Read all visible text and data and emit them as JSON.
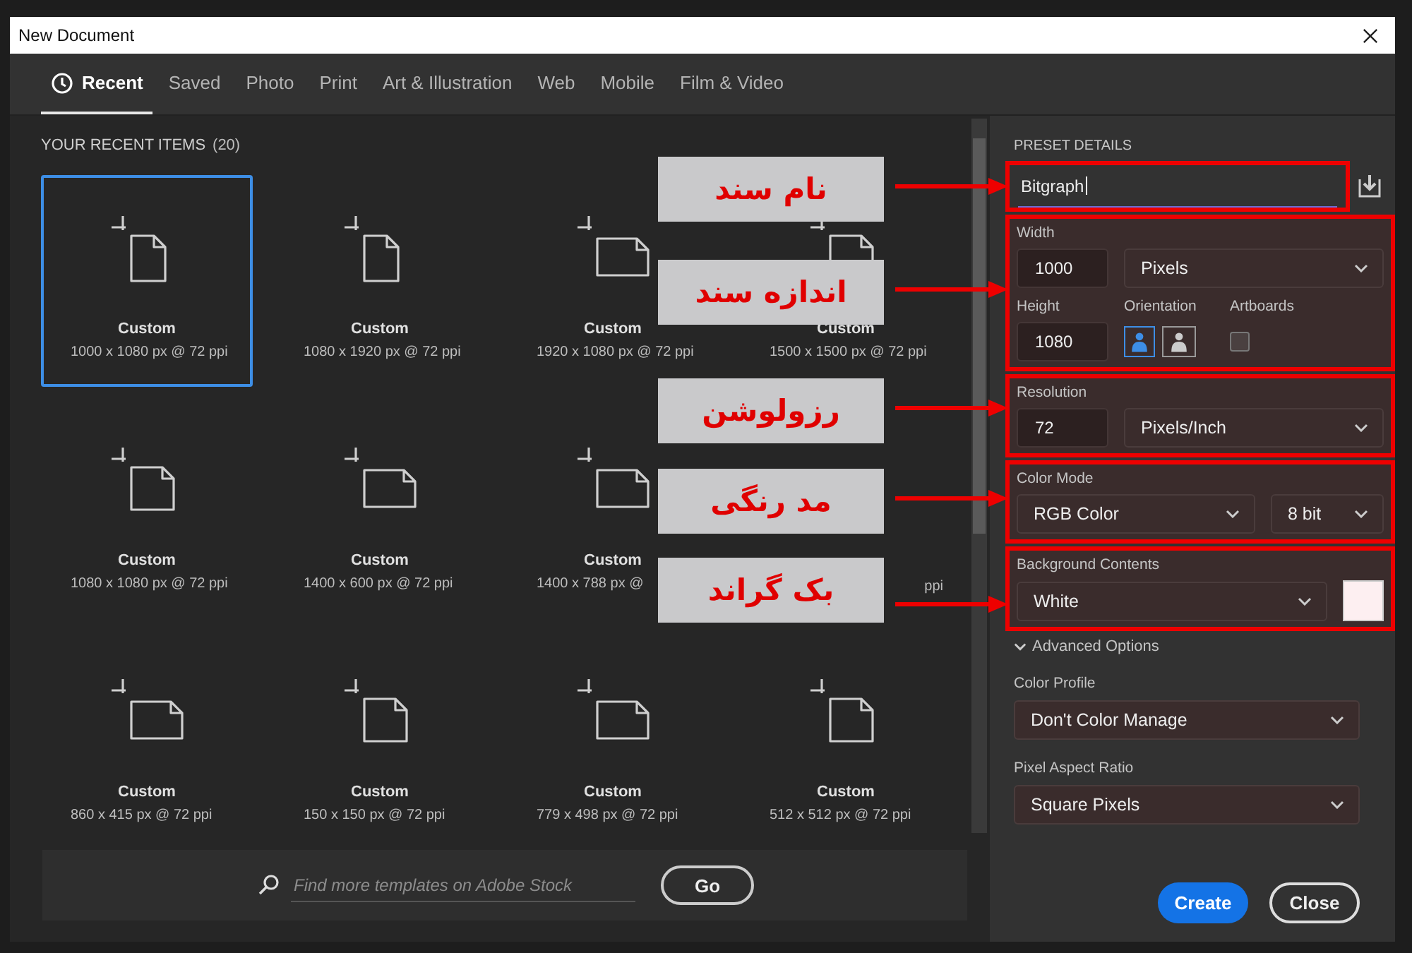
{
  "window": {
    "title": "New Document"
  },
  "tabs": [
    {
      "label": "Recent",
      "selected": true
    },
    {
      "label": "Saved",
      "selected": false
    },
    {
      "label": "Photo",
      "selected": false
    },
    {
      "label": "Print",
      "selected": false
    },
    {
      "label": "Art & Illustration",
      "selected": false
    },
    {
      "label": "Web",
      "selected": false
    },
    {
      "label": "Mobile",
      "selected": false
    },
    {
      "label": "Film & Video",
      "selected": false
    }
  ],
  "recent": {
    "heading": "YOUR RECENT ITEMS",
    "count": "(20)",
    "items": [
      {
        "name": "Custom",
        "size": "1000 x 1080 px @ 72 ppi",
        "kind": "portrait",
        "selected": true
      },
      {
        "name": "Custom",
        "size": "1080 x 1920 px @ 72 ppi",
        "kind": "portrait",
        "selected": false
      },
      {
        "name": "Custom",
        "size": "1920 x 1080 px @ 72 ppi",
        "kind": "landscape",
        "selected": false
      },
      {
        "name": "Custom",
        "size": "1500 x 1500 px @ 72 ppi",
        "kind": "square",
        "selected": false
      },
      {
        "name": "Custom",
        "size": "1080 x 1080 px @ 72 ppi",
        "kind": "square",
        "selected": false
      },
      {
        "name": "Custom",
        "size": "1400 x 600 px @ 72 ppi",
        "kind": "landscape",
        "selected": false
      },
      {
        "name": "Custom",
        "size": "1400 x 788 px @",
        "kind": "landscape",
        "selected": false
      },
      {
        "size": "ppi",
        "kind": "hidden",
        "selected": false
      },
      {
        "name": "Custom",
        "size": "860 x 415 px @ 72 ppi",
        "kind": "landscape",
        "selected": false
      },
      {
        "name": "Custom",
        "size": "150 x 150 px @ 72 ppi",
        "kind": "square",
        "selected": false
      },
      {
        "name": "Custom",
        "size": "779 x 498 px @ 72 ppi",
        "kind": "landscape",
        "selected": false
      },
      {
        "name": "Custom",
        "size": "512 x 512 px @ 72 ppi",
        "kind": "square",
        "selected": false
      }
    ]
  },
  "search": {
    "placeholder": "Find more templates on Adobe Stock",
    "button": "Go"
  },
  "preset": {
    "heading": "PRESET DETAILS",
    "name": "Bitgraph",
    "width": {
      "label": "Width",
      "value": "1000",
      "unit": "Pixels"
    },
    "height": {
      "label": "Height",
      "value": "1080"
    },
    "orientation": {
      "label": "Orientation",
      "options": [
        {
          "selected": true
        },
        {
          "selected": false
        }
      ]
    },
    "artboards": {
      "label": "Artboards",
      "checked": false
    },
    "resolution": {
      "label": "Resolution",
      "value": "72",
      "unit": "Pixels/Inch"
    },
    "color_mode": {
      "label": "Color Mode",
      "mode": "RGB Color",
      "depth": "8 bit"
    },
    "background": {
      "label": "Background Contents",
      "value": "White"
    },
    "advanced": {
      "label": "Advanced Options",
      "expanded": true
    },
    "color_profile": {
      "label": "Color Profile",
      "value": "Don't Color Manage"
    },
    "pixel_aspect": {
      "label": "Pixel Aspect Ratio",
      "value": "Square Pixels"
    }
  },
  "buttons": [
    {
      "label": "Create",
      "kind": "primary"
    },
    {
      "label": "Close",
      "kind": "secondary"
    }
  ],
  "annotations": [
    {
      "label": "نام سند"
    },
    {
      "label": "اندازه سند"
    },
    {
      "label": "رزولوشن"
    },
    {
      "label": "مد رنگی"
    },
    {
      "label": "بک گراند"
    }
  ]
}
